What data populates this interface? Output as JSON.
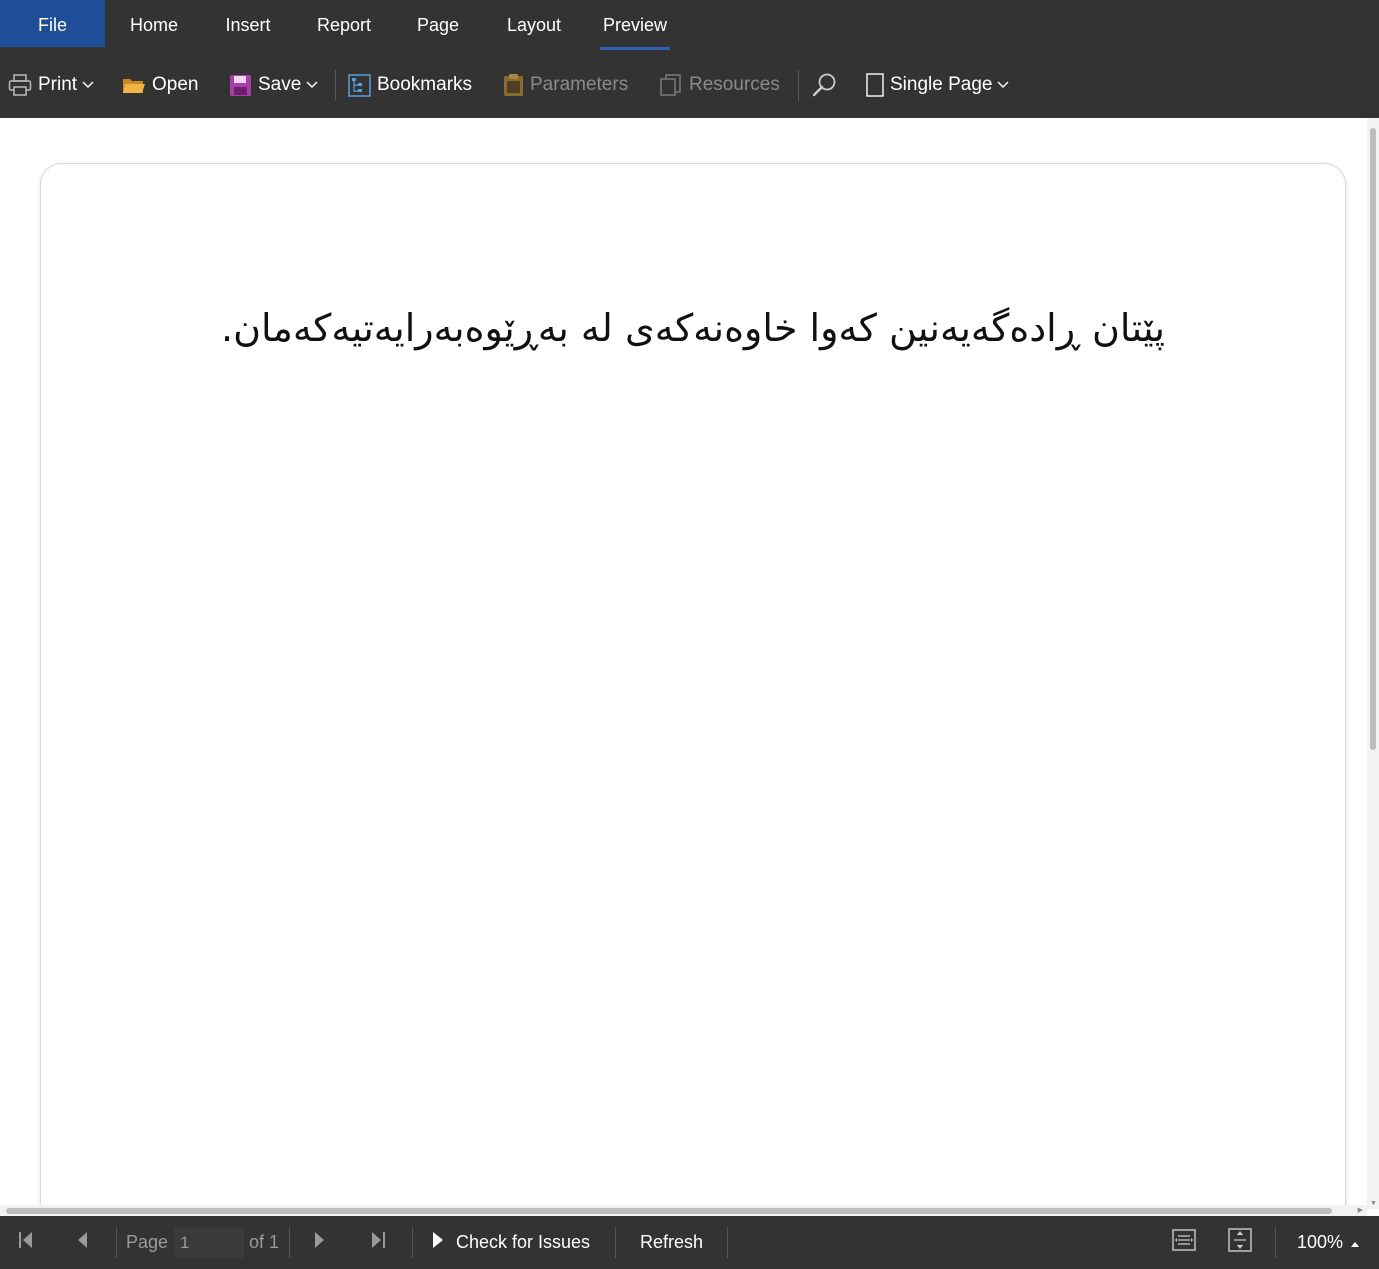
{
  "menu": {
    "tabs": [
      {
        "label": "File"
      },
      {
        "label": "Home"
      },
      {
        "label": "Insert"
      },
      {
        "label": "Report"
      },
      {
        "label": "Page"
      },
      {
        "label": "Layout"
      },
      {
        "label": "Preview"
      }
    ],
    "active_tab": "Preview"
  },
  "toolbar": {
    "print_label": "Print",
    "open_label": "Open",
    "save_label": "Save",
    "bookmarks_label": "Bookmarks",
    "parameters_label": "Parameters",
    "resources_label": "Resources",
    "view_mode_label": "Single Page"
  },
  "document": {
    "text": "پێتان ڕادەگەیەنین کەوا خاوەنەکەی لە بەڕێوەبەرایەتیەکەمان."
  },
  "statusbar": {
    "page_label": "Page",
    "page_value": "1",
    "page_of": "of 1",
    "check_label": "Check for Issues",
    "refresh_label": "Refresh",
    "zoom": "100%"
  },
  "colors": {
    "chrome_bg": "#333333",
    "file_tab_bg": "#1f4e99",
    "active_underline": "#2f5fb3",
    "open_icon": "#e8a23a",
    "save_icon": "#a63fa6",
    "bookmarks_icon": "#5aa0d8"
  }
}
